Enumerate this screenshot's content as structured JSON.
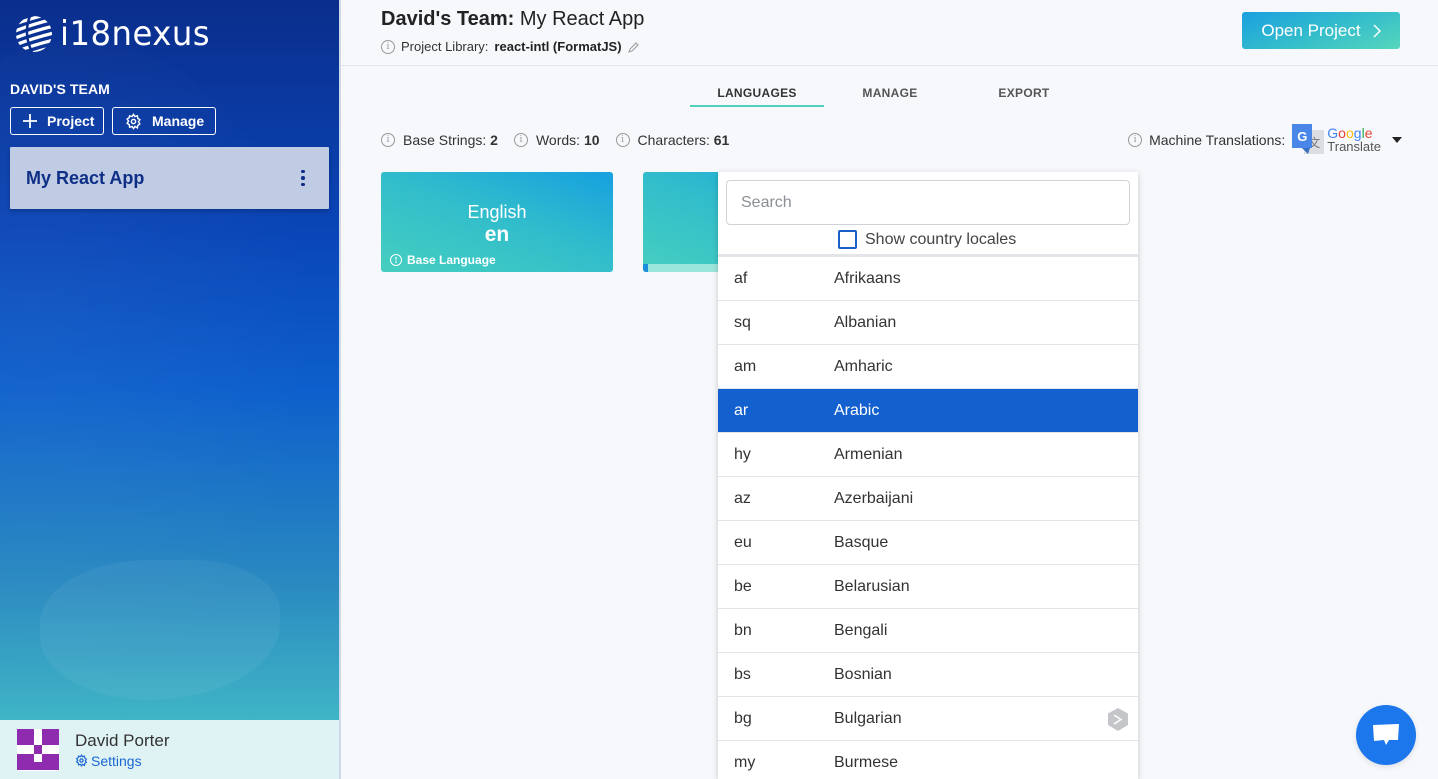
{
  "sidebar": {
    "brand": "i18nexus",
    "team_label": "DAVID'S TEAM",
    "buttons": {
      "project": "Project",
      "manage": "Manage"
    },
    "project_card": {
      "name": "My React App"
    },
    "user": {
      "name": "David Porter",
      "settings_label": "Settings"
    }
  },
  "header": {
    "team": "David's Team:",
    "project": "My React App",
    "library_label": "Project Library:",
    "library_value": "react-intl (FormatJS)",
    "open_button": "Open Project"
  },
  "tabs": [
    {
      "label": "LANGUAGES",
      "active": true
    },
    {
      "label": "MANAGE",
      "active": false
    },
    {
      "label": "EXPORT",
      "active": false
    }
  ],
  "stats": {
    "base_strings_label": "Base Strings:",
    "base_strings_value": "2",
    "words_label": "Words:",
    "words_value": "10",
    "characters_label": "Characters:",
    "characters_value": "61",
    "machine_translations_label": "Machine Translations:",
    "machine_translations_provider": {
      "line1": "Google",
      "line2": "Translate"
    }
  },
  "language_cards": [
    {
      "name": "English",
      "code": "en",
      "tag": "Base Language"
    },
    {
      "name": "",
      "code": "",
      "progress": 0.02
    }
  ],
  "dropdown": {
    "search_placeholder": "Search",
    "search_value": "",
    "country_locales_label": "Show country locales",
    "country_locales_checked": false,
    "selected_code": "ar",
    "languages": [
      {
        "code": "af",
        "name": "Afrikaans"
      },
      {
        "code": "sq",
        "name": "Albanian"
      },
      {
        "code": "am",
        "name": "Amharic"
      },
      {
        "code": "ar",
        "name": "Arabic"
      },
      {
        "code": "hy",
        "name": "Armenian"
      },
      {
        "code": "az",
        "name": "Azerbaijani"
      },
      {
        "code": "eu",
        "name": "Basque"
      },
      {
        "code": "be",
        "name": "Belarusian"
      },
      {
        "code": "bn",
        "name": "Bengali"
      },
      {
        "code": "bs",
        "name": "Bosnian"
      },
      {
        "code": "bg",
        "name": "Bulgarian"
      },
      {
        "code": "my",
        "name": "Burmese"
      }
    ]
  },
  "colors": {
    "accent_teal": "#4ed1bd",
    "selected_row": "#1360cf",
    "project_card": "#c0cbe4",
    "chat_button": "#1c76ec",
    "avatar": "#8e2bae"
  }
}
